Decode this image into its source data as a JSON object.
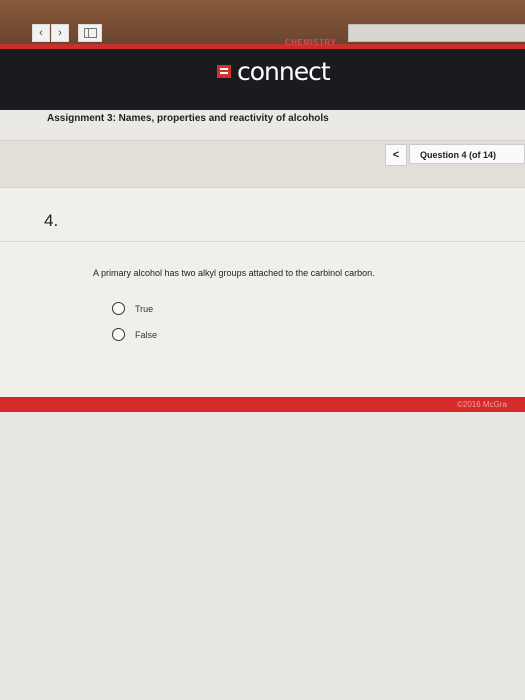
{
  "browser": {
    "back_icon": "chevron-left-icon",
    "forward_icon": "chevron-right-icon",
    "sidebar_icon": "sidebar-toggle-icon"
  },
  "brand": {
    "name": "connect",
    "subtitle": "CHEMISTRY",
    "accent_color": "#d0312d"
  },
  "assignment": {
    "title": "Assignment 3: Names, properties and reactivity of alcohols"
  },
  "question_nav": {
    "prev_label": "<",
    "counter": "Question 4 (of 14)"
  },
  "question": {
    "number": "4.",
    "text": "A primary alcohol has two alkyl groups attached to the carbinol carbon.",
    "options": [
      {
        "label": "True"
      },
      {
        "label": "False"
      }
    ]
  },
  "footer": {
    "copyright": "©2016 McGra"
  }
}
